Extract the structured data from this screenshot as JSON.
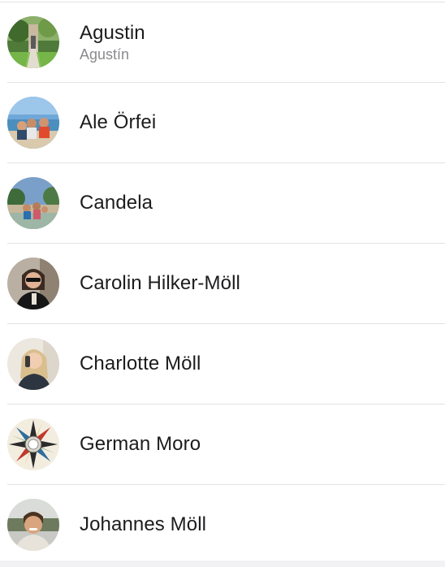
{
  "contacts": [
    {
      "name": "Agustin",
      "subtitle": "Agustín",
      "avatar": "photo-garden-path"
    },
    {
      "name": "Ale Örfei",
      "subtitle": "",
      "avatar": "photo-beach-group"
    },
    {
      "name": "Candela",
      "subtitle": "",
      "avatar": "photo-river-group"
    },
    {
      "name": "Carolin Hilker-Möll",
      "subtitle": "",
      "avatar": "photo-woman-sunglasses"
    },
    {
      "name": "Charlotte Möll",
      "subtitle": "",
      "avatar": "photo-woman-blonde"
    },
    {
      "name": "German Moro",
      "subtitle": "",
      "avatar": "image-compass-rose"
    },
    {
      "name": "Johannes Möll",
      "subtitle": "",
      "avatar": "photo-man-smiling"
    }
  ],
  "colors": {
    "separator": "#e3e3e6",
    "name_text": "#1c1c1e",
    "subtitle_text": "#8a8a8e"
  }
}
